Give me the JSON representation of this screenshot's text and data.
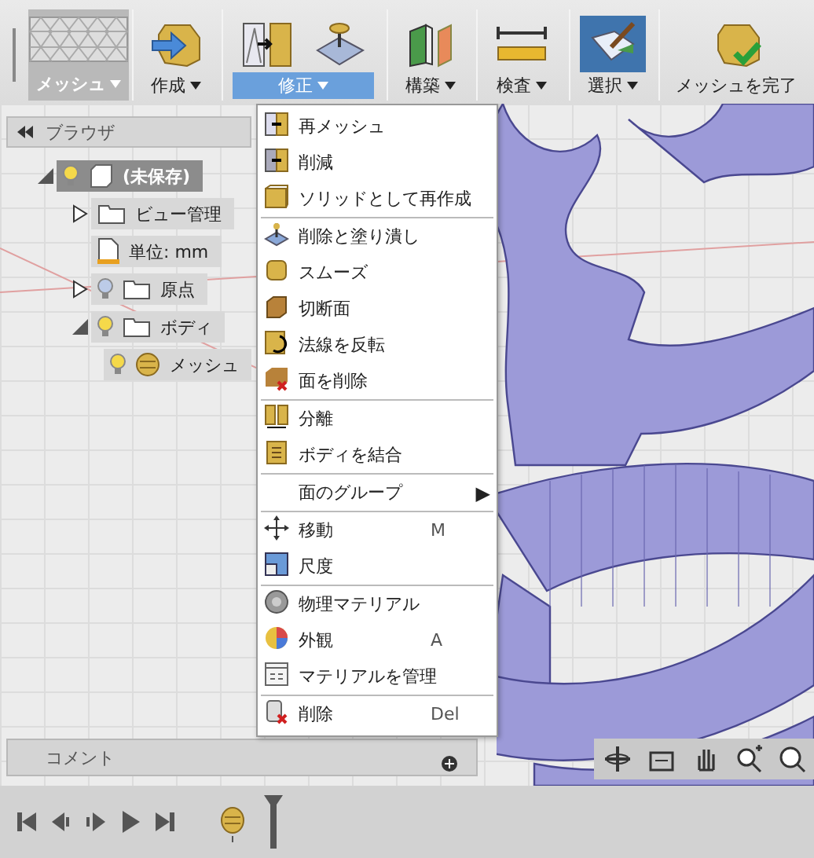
{
  "toolbar": {
    "workspace": {
      "label": "メッシュ",
      "dropdown": true
    },
    "groups": [
      {
        "label": "作成",
        "dropdown": true,
        "selected": false,
        "highlighted": false
      },
      {
        "label": "修正",
        "dropdown": true,
        "selected": true,
        "highlighted": false
      },
      {
        "label": "構築",
        "dropdown": true,
        "selected": false,
        "highlighted": false
      },
      {
        "label": "検査",
        "dropdown": true,
        "selected": false,
        "highlighted": false
      },
      {
        "label": "選択",
        "dropdown": true,
        "selected": false,
        "highlighted": true
      },
      {
        "label": "メッシュを完了",
        "dropdown": false,
        "selected": false,
        "highlighted": false
      }
    ]
  },
  "browser": {
    "title": "ブラウザ",
    "tree": [
      {
        "label": "(未保存)",
        "kind": "root",
        "selected": true,
        "expanded": true,
        "visible": true,
        "children": [
          {
            "label": "ビュー管理",
            "kind": "folder",
            "selected": false,
            "expanded": false
          },
          {
            "label": "単位: mm",
            "kind": "units",
            "selected": false
          },
          {
            "label": "原点",
            "kind": "folder",
            "selected": false,
            "expanded": false,
            "visible": false
          },
          {
            "label": "ボディ",
            "kind": "folder",
            "selected": false,
            "expanded": true,
            "visible": true,
            "children": [
              {
                "label": "メッシュ",
                "kind": "mesh",
                "selected": false,
                "visible": true
              }
            ]
          }
        ]
      }
    ]
  },
  "menu": {
    "sections": [
      [
        {
          "label": "再メッシュ"
        },
        {
          "label": "削減"
        },
        {
          "label": "ソリッドとして再作成"
        }
      ],
      [
        {
          "label": "削除と塗り潰し"
        },
        {
          "label": "スムーズ"
        },
        {
          "label": "切断面"
        },
        {
          "label": "法線を反転"
        },
        {
          "label": "面を削除"
        }
      ],
      [
        {
          "label": "分離"
        },
        {
          "label": "ボディを結合"
        }
      ],
      [
        {
          "label": "面のグループ",
          "submenu": "▶"
        }
      ],
      [
        {
          "label": "移動",
          "shortcut": "M"
        },
        {
          "label": "尺度"
        }
      ],
      [
        {
          "label": "物理マテリアル"
        },
        {
          "label": "外観",
          "shortcut": "A"
        },
        {
          "label": "マテリアルを管理"
        }
      ],
      [
        {
          "label": "削除",
          "shortcut": "Del"
        }
      ]
    ]
  },
  "comments": {
    "title": "コメント"
  }
}
